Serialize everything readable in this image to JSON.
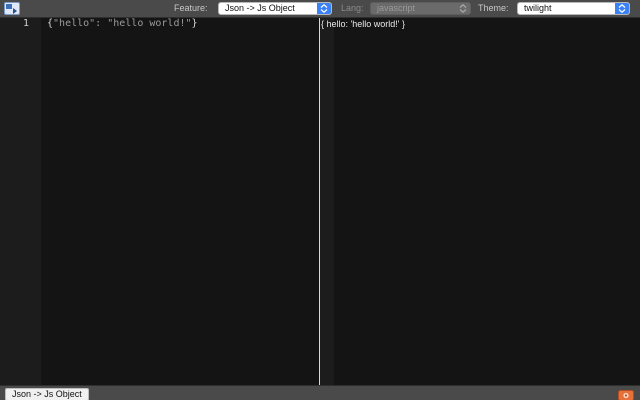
{
  "toolbar": {
    "feature_label": "Feature:",
    "feature_value": "Json -> Js Object",
    "lang_label": "Lang:",
    "lang_value": "javascript",
    "theme_label": "Theme:",
    "theme_value": "twilight",
    "accent_color": "#3b82f6"
  },
  "editor": {
    "line_numbers": [
      "1"
    ],
    "input_lines": [
      {
        "open": "{",
        "content": "\"hello\": \"hello world!\"",
        "close": "}"
      }
    ]
  },
  "output": {
    "lines": [
      "{ hello: 'hello world!' }"
    ]
  },
  "statusbar": {
    "mode_button": "Json -> Js Object",
    "icons": [
      "app-icon",
      "orange-badge-icon"
    ]
  }
}
